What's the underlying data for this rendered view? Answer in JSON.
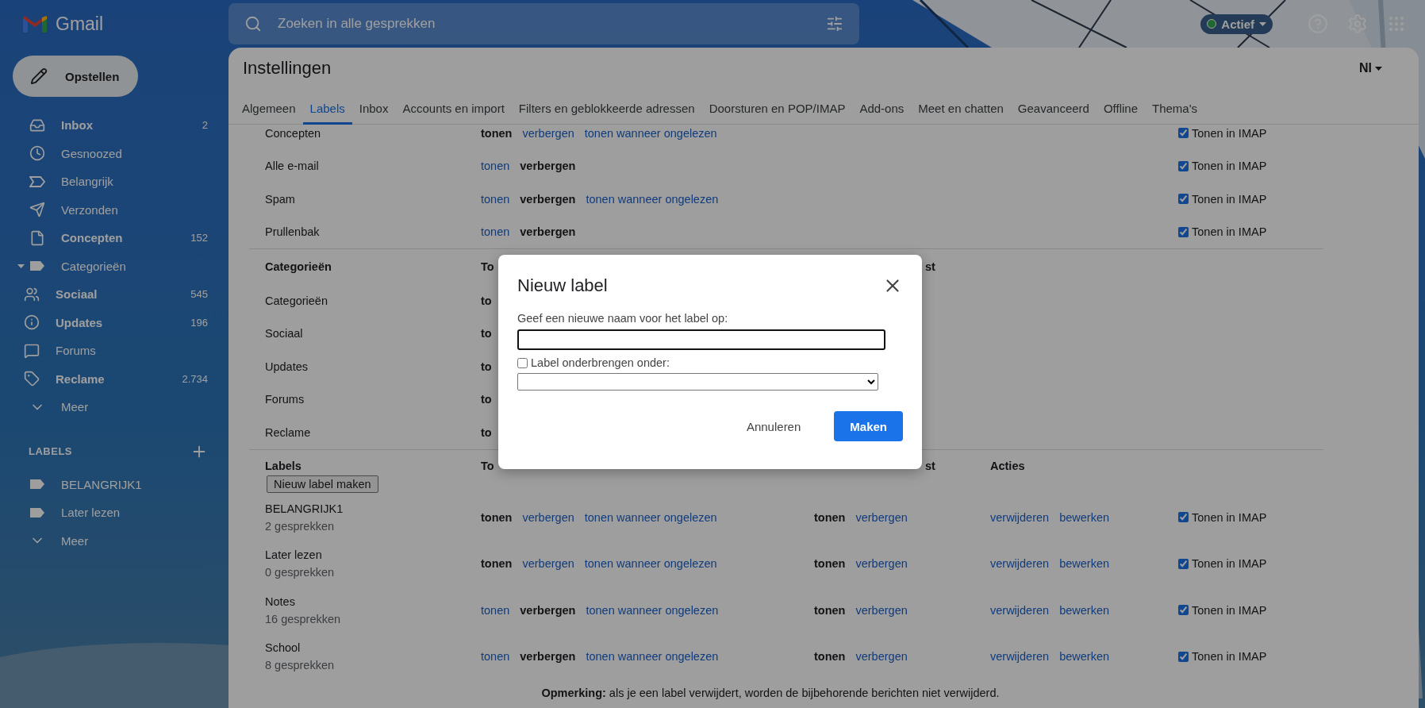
{
  "topbar": {
    "brand": "Gmail",
    "search": {
      "placeholder": "Zoeken in alle gesprekken"
    },
    "status": "Actief"
  },
  "sidebar": {
    "compose": "Opstellen",
    "items": [
      {
        "label": "Inbox",
        "count": "2",
        "bold": true,
        "kind": "folder"
      },
      {
        "label": "Gesnoozed",
        "bold": false,
        "kind": "folder"
      },
      {
        "label": "Belangrijk",
        "bold": false,
        "kind": "folder"
      },
      {
        "label": "Verzonden",
        "bold": false,
        "kind": "folder"
      },
      {
        "label": "Concepten",
        "count": "152",
        "bold": true,
        "kind": "folder"
      },
      {
        "label": "Categorieën",
        "bold": false,
        "kind": "folder",
        "expanded": true,
        "children": [
          {
            "label": "Sociaal",
            "count": "545",
            "bold": true
          },
          {
            "label": "Updates",
            "count": "196",
            "bold": true
          },
          {
            "label": "Forums",
            "bold": false
          },
          {
            "label": "Reclame",
            "count": "2.734",
            "bold": true
          }
        ]
      },
      {
        "label": "Meer",
        "bold": false,
        "kind": "more"
      }
    ],
    "labels_heading": "LABELS",
    "labels": [
      {
        "label": "BELANGRIJK1",
        "kind": "label"
      },
      {
        "label": "Later lezen",
        "kind": "label"
      },
      {
        "label": "Meer",
        "kind": "more"
      }
    ]
  },
  "settings": {
    "title": "Instellingen",
    "language": "Nl",
    "tabs": [
      {
        "label": "Algemeen",
        "selected": false
      },
      {
        "label": "Labels",
        "selected": true
      },
      {
        "label": "Inbox",
        "selected": false
      },
      {
        "label": "Accounts en import",
        "selected": false
      },
      {
        "label": "Filters en geblokkeerde adressen",
        "selected": false
      },
      {
        "label": "Doorsturen en POP/IMAP",
        "selected": false
      },
      {
        "label": "Add-ons",
        "selected": false
      },
      {
        "label": "Meet en chatten",
        "selected": false
      },
      {
        "label": "Geavanceerd",
        "selected": false
      },
      {
        "label": "Offline",
        "selected": false
      },
      {
        "label": "Thema's",
        "selected": false
      }
    ],
    "system_labels": [
      {
        "name": "Concepten",
        "options": [
          {
            "text": "tonen",
            "selected": true
          },
          {
            "text": "verbergen",
            "selected": false
          },
          {
            "text": "tonen wanneer ongelezen",
            "selected": false
          }
        ],
        "imap": {
          "label": "Tonen in IMAP",
          "checked": true
        }
      },
      {
        "name": "Alle e-mail",
        "options": [
          {
            "text": "tonen",
            "selected": false
          },
          {
            "text": "verbergen",
            "selected": true
          }
        ],
        "imap": {
          "label": "Tonen in IMAP",
          "checked": true
        }
      },
      {
        "name": "Spam",
        "options": [
          {
            "text": "tonen",
            "selected": false
          },
          {
            "text": "verbergen",
            "selected": true
          },
          {
            "text": "tonen wanneer ongelezen",
            "selected": false
          }
        ],
        "imap": {
          "label": "Tonen in IMAP",
          "checked": true
        }
      },
      {
        "name": "Prullenbak",
        "options": [
          {
            "text": "tonen",
            "selected": false
          },
          {
            "text": "verbergen",
            "selected": true
          }
        ],
        "imap": {
          "label": "Tonen in IMAP",
          "checked": true
        }
      }
    ],
    "categories": {
      "header": {
        "title": "Categorieën",
        "column_2": "To",
        "column_3": "st"
      },
      "rows": [
        {
          "name": "Categorieën",
          "column_2": "to"
        },
        {
          "name": "Sociaal",
          "column_2": "to"
        },
        {
          "name": "Updates",
          "column_2": "to"
        },
        {
          "name": "Forums",
          "column_2": "to"
        },
        {
          "name": "Reclame",
          "column_2": "to"
        }
      ]
    },
    "labels": {
      "header": {
        "title": "Labels",
        "column_2": "To",
        "column_3": "st",
        "actions": "Acties"
      },
      "new_button": "Nieuw label maken",
      "rows": [
        {
          "name": "BELANGRIJK1",
          "count": "2 gesprekken",
          "list_options": [
            {
              "text": "tonen",
              "selected": true
            },
            {
              "text": "verbergen",
              "selected": false
            },
            {
              "text": "tonen wanneer ongelezen",
              "selected": false
            }
          ],
          "message_options": [
            {
              "text": "tonen",
              "selected": true
            },
            {
              "text": "verbergen",
              "selected": false
            }
          ],
          "actions": [
            "verwijderen",
            "bewerken"
          ],
          "imap": {
            "label": "Tonen in IMAP",
            "checked": true
          }
        },
        {
          "name": "Later lezen",
          "count": "0 gesprekken",
          "list_options": [
            {
              "text": "tonen",
              "selected": true
            },
            {
              "text": "verbergen",
              "selected": false
            },
            {
              "text": "tonen wanneer ongelezen",
              "selected": false
            }
          ],
          "message_options": [
            {
              "text": "tonen",
              "selected": true
            },
            {
              "text": "verbergen",
              "selected": false
            }
          ],
          "actions": [
            "verwijderen",
            "bewerken"
          ],
          "imap": {
            "label": "Tonen in IMAP",
            "checked": true
          }
        },
        {
          "name": "Notes",
          "count": "16 gesprekken",
          "list_options": [
            {
              "text": "tonen",
              "selected": false
            },
            {
              "text": "verbergen",
              "selected": true
            },
            {
              "text": "tonen wanneer ongelezen",
              "selected": false
            }
          ],
          "message_options": [
            {
              "text": "tonen",
              "selected": true
            },
            {
              "text": "verbergen",
              "selected": false
            }
          ],
          "actions": [
            "verwijderen",
            "bewerken"
          ],
          "imap": {
            "label": "Tonen in IMAP",
            "checked": true
          }
        },
        {
          "name": "School",
          "count": "8 gesprekken",
          "list_options": [
            {
              "text": "tonen",
              "selected": false
            },
            {
              "text": "verbergen",
              "selected": true
            },
            {
              "text": "tonen wanneer ongelezen",
              "selected": false
            }
          ],
          "message_options": [
            {
              "text": "tonen",
              "selected": true
            },
            {
              "text": "verbergen",
              "selected": false
            }
          ],
          "actions": [
            "verwijderen",
            "bewerken"
          ],
          "imap": {
            "label": "Tonen in IMAP",
            "checked": true
          }
        }
      ]
    },
    "note": "**Opmerking:** als je een label verwijdert, worden de bijbehorende berichten niet verwijderd."
  },
  "dialog": {
    "title": "Nieuw label",
    "prompt": "Geef een nieuwe naam voor het label op:",
    "nest": {
      "label": "Label onderbrengen onder:",
      "checked": false
    },
    "buttons": [
      {
        "text": "Annuleren",
        "kind": "secondary"
      },
      {
        "text": "Maken",
        "kind": "primary"
      }
    ]
  }
}
